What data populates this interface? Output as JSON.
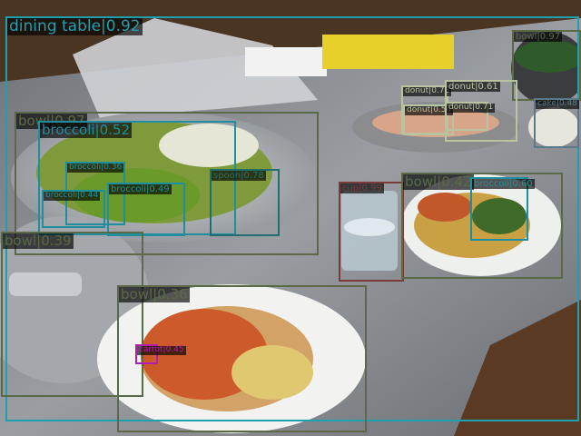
{
  "detections": [
    {
      "label": "dining table|0.92",
      "color": "#1f9fb0",
      "size": "xl"
    },
    {
      "label": "bowl|0.97",
      "color": "#5a6a46",
      "size": "l"
    },
    {
      "label": "broccoli|0.52",
      "color": "#1f8f9f",
      "size": "l"
    },
    {
      "label": "broccoli|0.36",
      "color": "#1f8f9f",
      "size": "xs"
    },
    {
      "label": "broccoli|0.44",
      "color": "#1f8f9f",
      "size": "xs"
    },
    {
      "label": "broccoli|0.49",
      "color": "#1f8f9f",
      "size": "s"
    },
    {
      "label": "spoon|0.78",
      "color": "#1f6f6f",
      "size": "s"
    },
    {
      "label": "bowl|0.39",
      "color": "#5a6a46",
      "size": "l"
    },
    {
      "label": "bowl|0.36",
      "color": "#5a6a46",
      "size": "l"
    },
    {
      "label": "carrot|0.45",
      "color": "#b01fb0",
      "size": "xs"
    },
    {
      "label": "cup|0.99",
      "color": "#7a3a3a",
      "size": "s"
    },
    {
      "label": "bowl|0.42",
      "color": "#5a6a46",
      "size": "l"
    },
    {
      "label": "broccoli|0.60",
      "color": "#1f8f9f",
      "size": "s"
    },
    {
      "label": "bowl|0.97",
      "color": "#5a6a46",
      "size": "s"
    },
    {
      "label": "cake|0.48",
      "color": "#5a7a8a",
      "size": "xs"
    },
    {
      "label": "donut|0.78",
      "color": "#b8c4a0",
      "size": "xs"
    },
    {
      "label": "donut|0.61",
      "color": "#b8c4a0",
      "size": "s"
    },
    {
      "label": "donut|0.54",
      "color": "#b8c4a0",
      "size": "xs"
    },
    {
      "label": "donut|0.71",
      "color": "#b8c4a0",
      "size": "xs"
    }
  ]
}
